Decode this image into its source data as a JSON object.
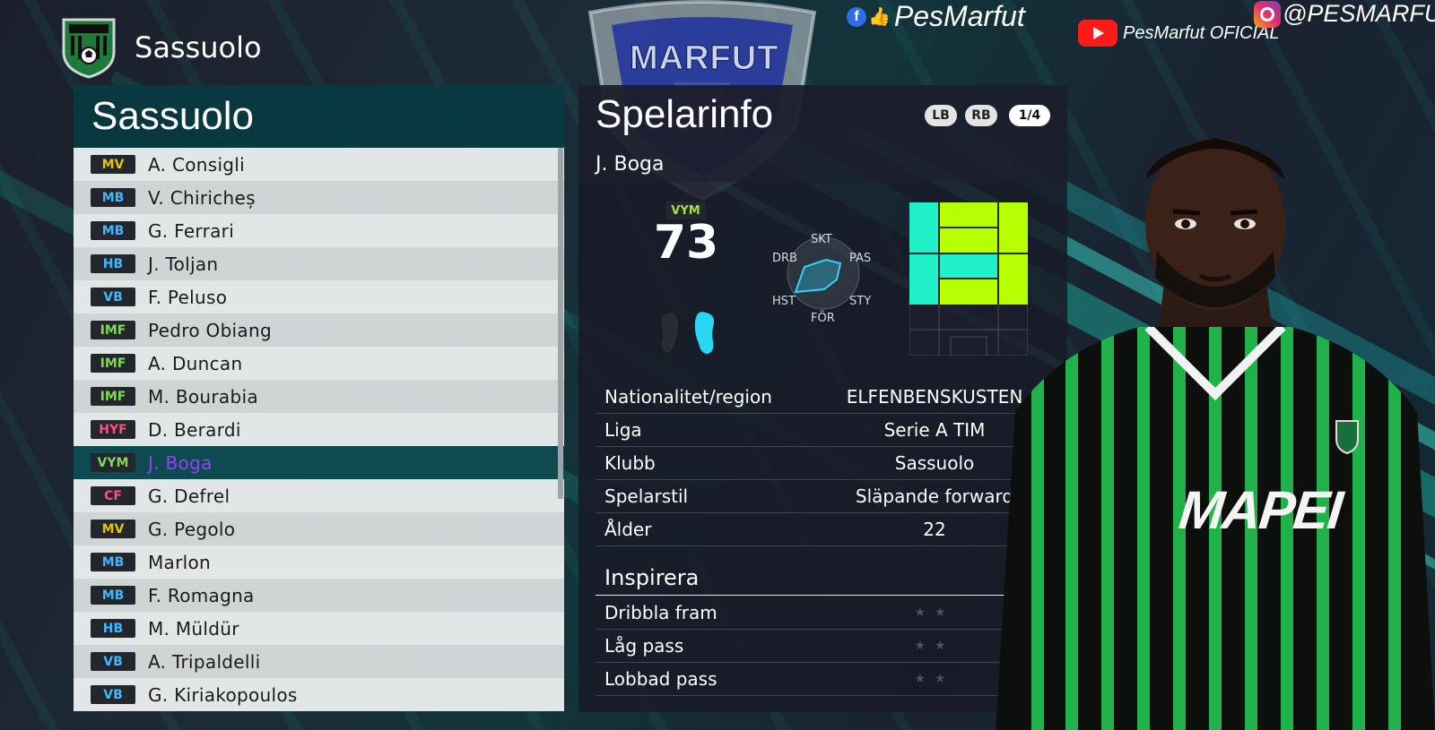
{
  "header": {
    "title": "Sassuolo"
  },
  "watermark": {
    "logo_text": "MARFUT"
  },
  "social": {
    "facebook": "PesMarfut",
    "youtube": "PesMarfut OFICIAL",
    "instagram": "@PESMARFUT"
  },
  "team_list": {
    "title": "Sassuolo",
    "players": [
      {
        "pos": "MV",
        "name": "A. Consigli",
        "pos_color": "#e6c600"
      },
      {
        "pos": "MB",
        "name": "V. Chiricheș",
        "pos_color": "#3fb8ff"
      },
      {
        "pos": "MB",
        "name": "G. Ferrari",
        "pos_color": "#3fb8ff"
      },
      {
        "pos": "HB",
        "name": "J. Toljan",
        "pos_color": "#3fb8ff"
      },
      {
        "pos": "VB",
        "name": "F. Peluso",
        "pos_color": "#3fb8ff"
      },
      {
        "pos": "IMF",
        "name": "Pedro Obiang",
        "pos_color": "#7ed957"
      },
      {
        "pos": "IMF",
        "name": "A. Duncan",
        "pos_color": "#7ed957"
      },
      {
        "pos": "IMF",
        "name": "M. Bourabia",
        "pos_color": "#7ed957"
      },
      {
        "pos": "HYF",
        "name": "D. Berardi",
        "pos_color": "#ff4f7b"
      },
      {
        "pos": "VYM",
        "name": "J. Boga",
        "pos_color": "#7ed957",
        "selected": true
      },
      {
        "pos": "CF",
        "name": "G. Defrel",
        "pos_color": "#ff4f7b"
      },
      {
        "pos": "MV",
        "name": "G. Pegolo",
        "pos_color": "#e6c600"
      },
      {
        "pos": "MB",
        "name": "Marlon",
        "pos_color": "#3fb8ff"
      },
      {
        "pos": "MB",
        "name": "F. Romagna",
        "pos_color": "#3fb8ff"
      },
      {
        "pos": "HB",
        "name": "M. Müldür",
        "pos_color": "#3fb8ff"
      },
      {
        "pos": "VB",
        "name": "A. Tripaldelli",
        "pos_color": "#3fb8ff"
      },
      {
        "pos": "VB",
        "name": "G. Kiriakopoulos",
        "pos_color": "#3fb8ff"
      }
    ]
  },
  "player_info": {
    "title": "Spelarinfo",
    "name": "J. Boga",
    "buttons": {
      "lb": "LB",
      "rb": "RB",
      "page": "1/4"
    },
    "position": "VYM",
    "rating": "73",
    "radar": {
      "top": "SKT",
      "top_right": "PAS",
      "bottom_right": "STY",
      "bottom": "FÖR",
      "bottom_left": "HST",
      "top_left": "DRB"
    },
    "details": [
      {
        "label": "Nationalitet/region",
        "value": "ELFENBENSKUSTEN"
      },
      {
        "label": "Liga",
        "value": "Serie A TIM"
      },
      {
        "label": "Klubb",
        "value": "Sassuolo"
      },
      {
        "label": "Spelarstil",
        "value": "Släpande forward"
      },
      {
        "label": "Ålder",
        "value": "22"
      }
    ],
    "inspire": {
      "title": "Inspirera",
      "items": [
        {
          "label": "Dribbla fram",
          "stars": "★★"
        },
        {
          "label": "Låg pass",
          "stars": "★★"
        },
        {
          "label": "Lobbad pass",
          "stars": "★★"
        }
      ]
    }
  },
  "kit": {
    "sponsor": "MAPEI"
  }
}
